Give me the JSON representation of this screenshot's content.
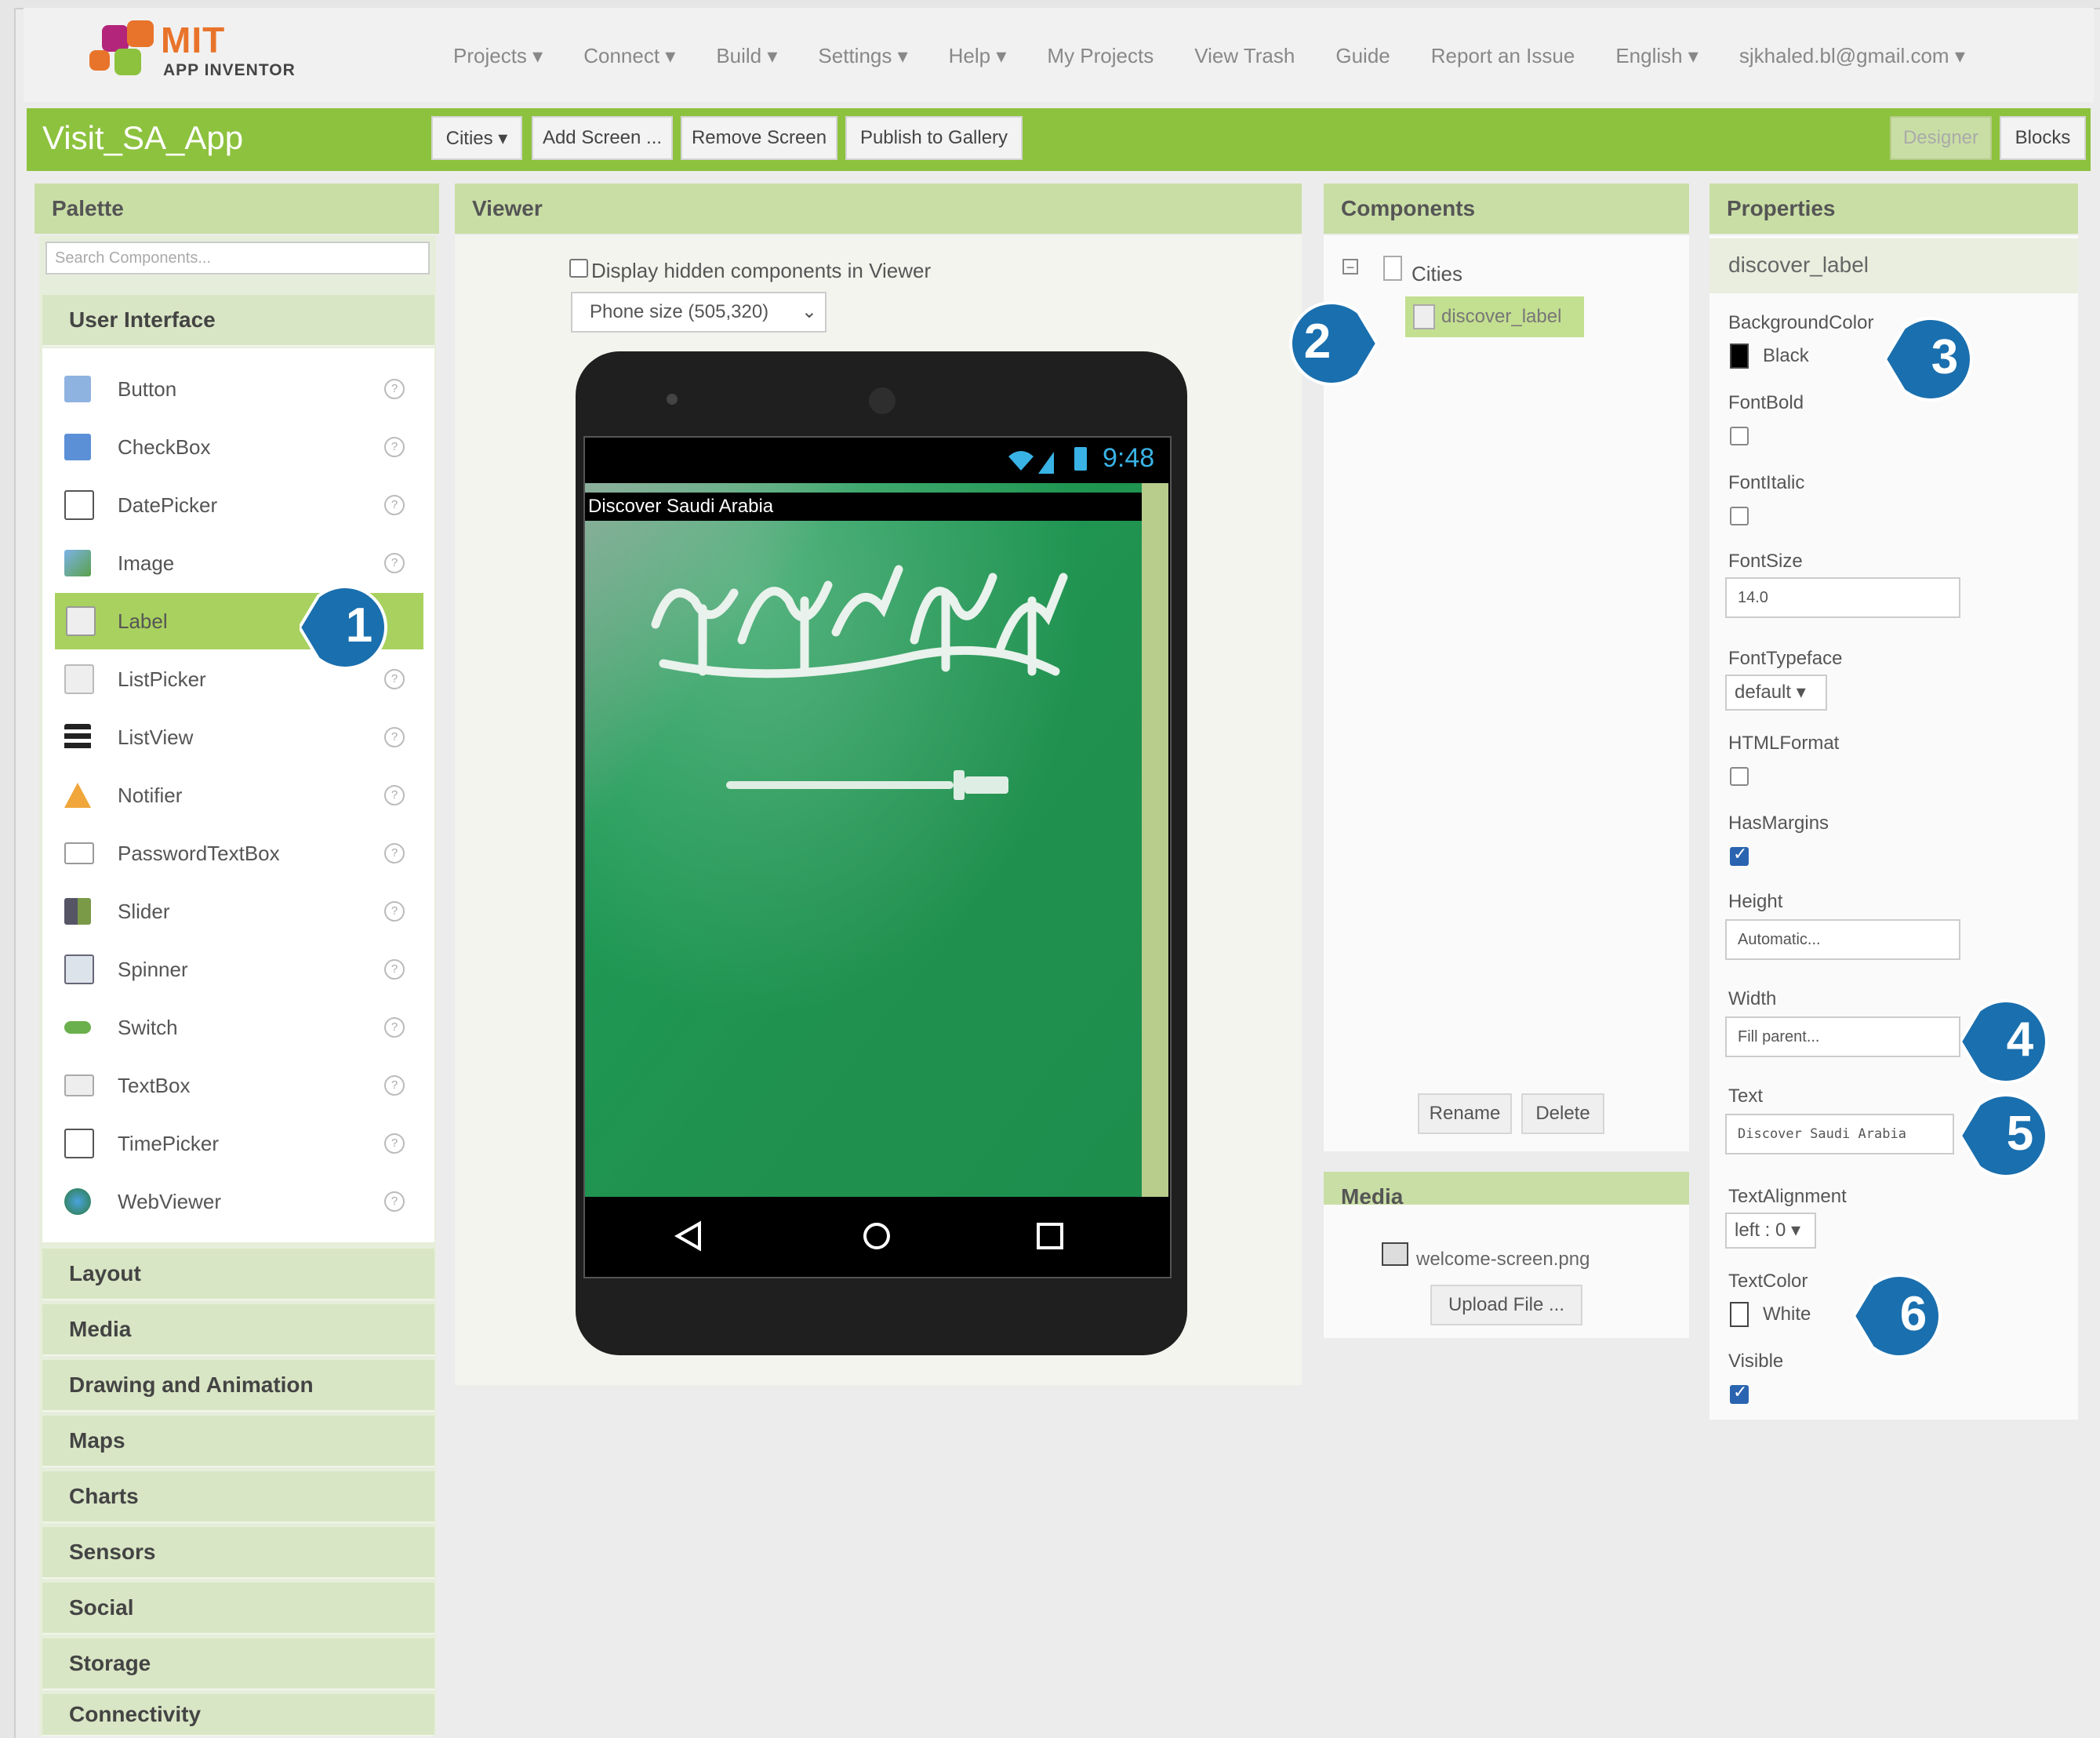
{
  "logo": {
    "mit": "MIT",
    "subtitle": "APP INVENTOR"
  },
  "top_menu": [
    "Projects ▾",
    "Connect ▾",
    "Build ▾",
    "Settings ▾",
    "Help ▾",
    "My Projects",
    "View Trash",
    "Guide",
    "Report an Issue",
    "English ▾",
    "sjkhaled.bl@gmail.com ▾"
  ],
  "project": {
    "title": "Visit_SA_App",
    "screen_select": "Cities ▾",
    "add_screen": "Add Screen ...",
    "remove_screen": "Remove Screen",
    "publish": "Publish to Gallery",
    "designer": "Designer",
    "blocks": "Blocks"
  },
  "palette": {
    "title": "Palette",
    "search_placeholder": "Search Components...",
    "user_interface": "User Interface",
    "items": [
      "Button",
      "CheckBox",
      "DatePicker",
      "Image",
      "Label",
      "ListPicker",
      "ListView",
      "Notifier",
      "PasswordTextBox",
      "Slider",
      "Spinner",
      "Switch",
      "TextBox",
      "TimePicker",
      "WebViewer"
    ],
    "help_glyph": "?",
    "categories": [
      "Layout",
      "Media",
      "Drawing and Animation",
      "Maps",
      "Charts",
      "Sensors",
      "Social",
      "Storage",
      "Connectivity"
    ]
  },
  "viewer": {
    "title": "Viewer",
    "hidden_checkbox": "Display hidden components in Viewer",
    "phone_size": "Phone size (505,320)",
    "clock": "9:48",
    "label_text": "Discover Saudi Arabia"
  },
  "components": {
    "title": "Components",
    "root": "Cities",
    "child": "discover_label",
    "rename": "Rename",
    "delete": "Delete"
  },
  "media": {
    "title": "Media",
    "file": "welcome-screen.png",
    "upload": "Upload File ..."
  },
  "properties": {
    "title": "Properties",
    "component": "discover_label",
    "bg_color_label": "BackgroundColor",
    "bg_color_value": "Black",
    "font_bold": "FontBold",
    "font_italic": "FontItalic",
    "font_size_label": "FontSize",
    "font_size_value": "14.0",
    "font_typeface_label": "FontTypeface",
    "font_typeface_value": "default ▾",
    "html_format": "HTMLFormat",
    "has_margins": "HasMargins",
    "height_label": "Height",
    "height_value": "Automatic...",
    "width_label": "Width",
    "width_value": "Fill parent...",
    "text_label": "Text",
    "text_value": "Discover Saudi Arabia",
    "text_alignment_label": "TextAlignment",
    "text_alignment_value": "left : 0 ▾",
    "text_color_label": "TextColor",
    "text_color_value": "White",
    "visible": "Visible"
  },
  "callouts": [
    "1",
    "2",
    "3",
    "4",
    "5",
    "6"
  ],
  "colors": {
    "accent_green": "#8dc23e",
    "selected_green": "#a9d15f",
    "callout_blue": "#1a6fae"
  }
}
